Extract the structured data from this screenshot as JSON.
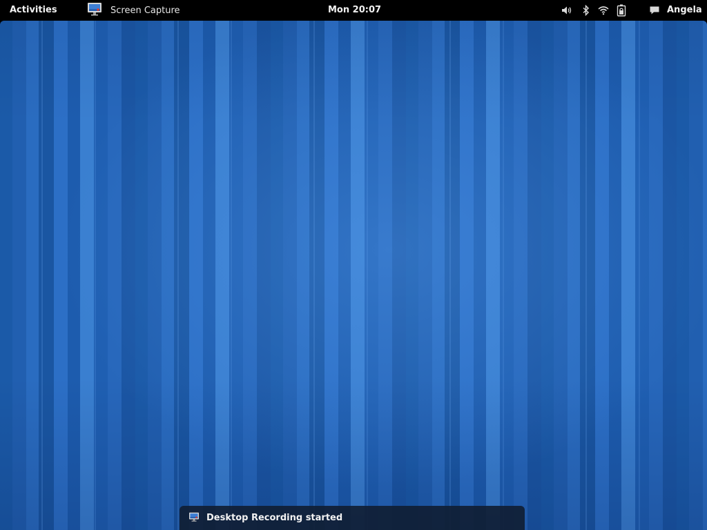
{
  "top_bar": {
    "activities_label": "Activities",
    "app_name": "Screen Capture",
    "app_icon": "monitor-icon",
    "clock": "Mon 20:07",
    "status_icons": [
      "volume-icon",
      "bluetooth-icon",
      "wifi-icon",
      "battery-icon",
      "chat-icon"
    ],
    "user_name": "Angela"
  },
  "notification": {
    "icon": "monitor-icon",
    "text": "Desktop Recording started"
  },
  "colors": {
    "top_bar": "#000000",
    "desktop_base": "#1e62b8",
    "notification_bg": "#101e34",
    "text": "#f2f2f2"
  }
}
